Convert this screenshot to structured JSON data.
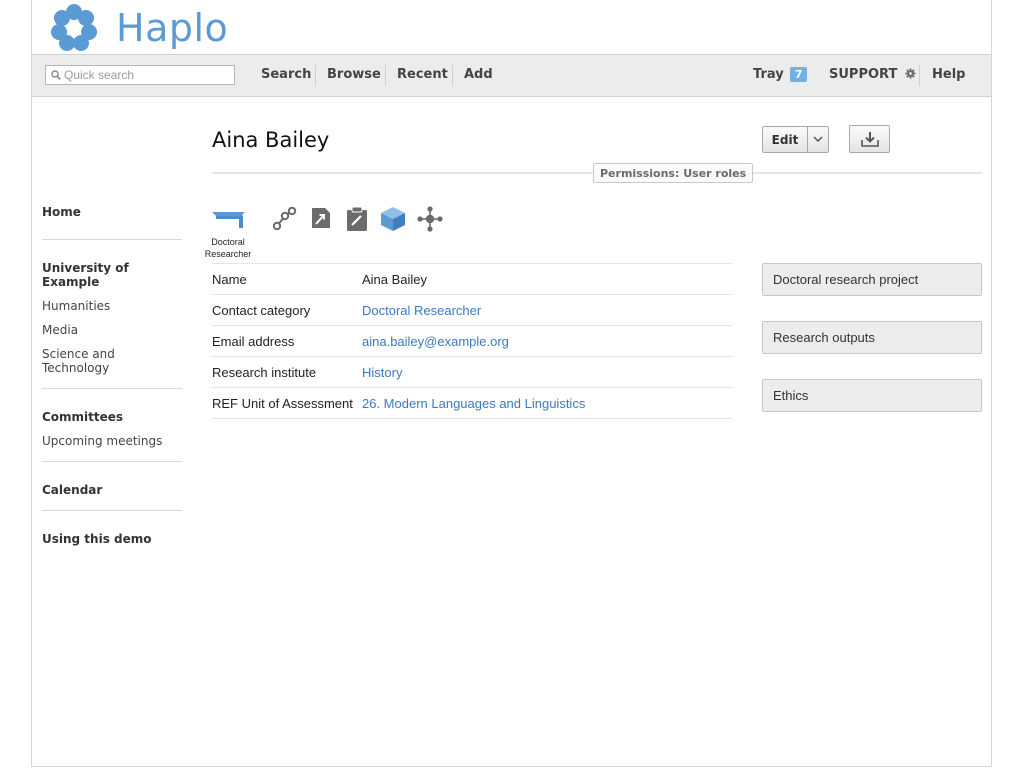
{
  "brand": {
    "name": "Haplo",
    "logo_icon": "flower-logo-icon",
    "color": "#5b9bd5"
  },
  "navbar": {
    "search_placeholder": "Quick search",
    "links": {
      "search": "Search",
      "browse": "Browse",
      "recent": "Recent",
      "add": "Add"
    },
    "tray": {
      "label": "Tray",
      "count": "7"
    },
    "support": "SUPPORT",
    "help": "Help"
  },
  "sidebar": {
    "home": "Home",
    "org": {
      "title": "University of Example",
      "items": [
        "Humanities",
        "Media",
        "Science and Technology"
      ]
    },
    "committees": {
      "title": "Committees",
      "items": [
        "Upcoming meetings"
      ]
    },
    "calendar": "Calendar",
    "demo": "Using this demo"
  },
  "record": {
    "title": "Aina Bailey",
    "edit_label": "Edit",
    "permissions_badge": "Permissions: User roles",
    "type_caption": "Doctoral Researcher",
    "attributes": [
      {
        "label": "Name",
        "value": "Aina Bailey"
      },
      {
        "label": "Contact category",
        "value": "Doctoral Researcher"
      },
      {
        "label": "Email address",
        "value": "aina.bailey@example.org"
      },
      {
        "label": "Research institute",
        "value": "History"
      },
      {
        "label": "REF Unit of Assessment",
        "value": "26. Modern Languages and Linguistics"
      }
    ]
  },
  "panels": [
    "Doctoral research project",
    "Research outputs",
    "Ethics"
  ],
  "colors": {
    "link": "#3a7ac3",
    "icon_blue": "#5b9bd5",
    "icon_gray": "#6b6b6b",
    "navbar_bg": "#ececec"
  }
}
